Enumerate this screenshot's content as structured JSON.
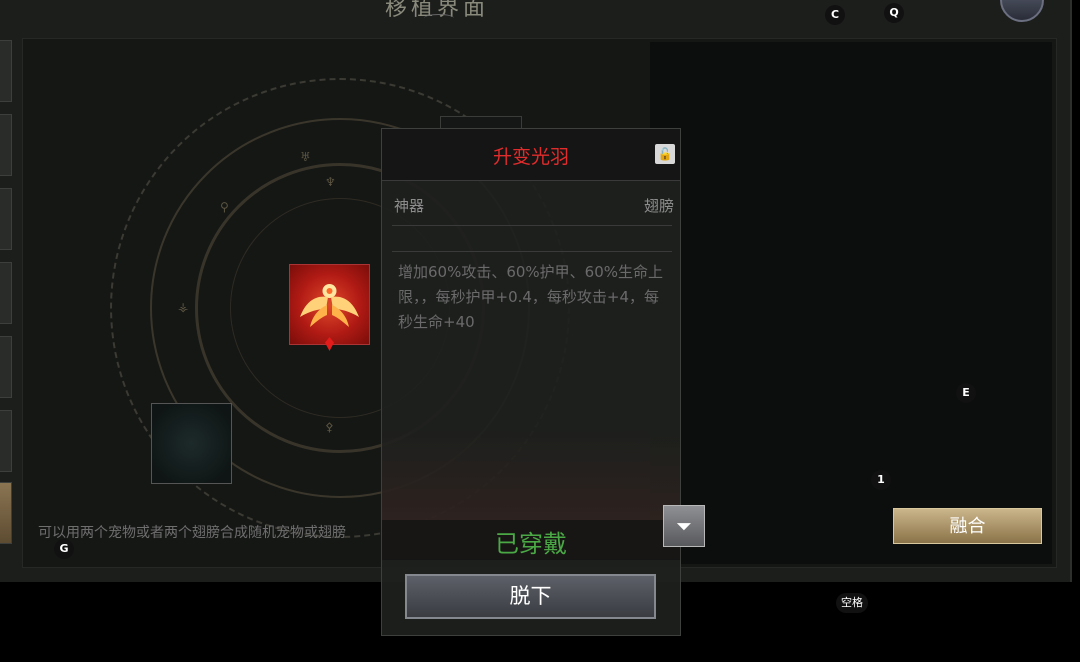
{
  "header": {
    "title": "移植界面"
  },
  "hotkeys": {
    "c": "C",
    "q": "Q",
    "e": "E",
    "one": "1",
    "g": "G",
    "space": "空格"
  },
  "panel": {
    "hint": "可以用两个宠物或者两个翅膀合成随机宠物或翅膀",
    "fuse_label": "融合"
  },
  "tooltip": {
    "title": "升变光羽",
    "category": "神器",
    "type": "翅膀",
    "description": "增加60%攻击、60%护甲、60%生命上限，，每秒护甲+0.4，每秒攻击+4，每秒生命+40",
    "status": "已穿戴",
    "unequip_label": "脱下"
  },
  "icons": {
    "lock": "unlock-icon",
    "filter": "filter-icon",
    "item": "phoenix-wing-icon"
  },
  "colors": {
    "title_red": "#e02c2c",
    "status_green": "#4aa845",
    "fuse_gold": "#cbb58a"
  }
}
